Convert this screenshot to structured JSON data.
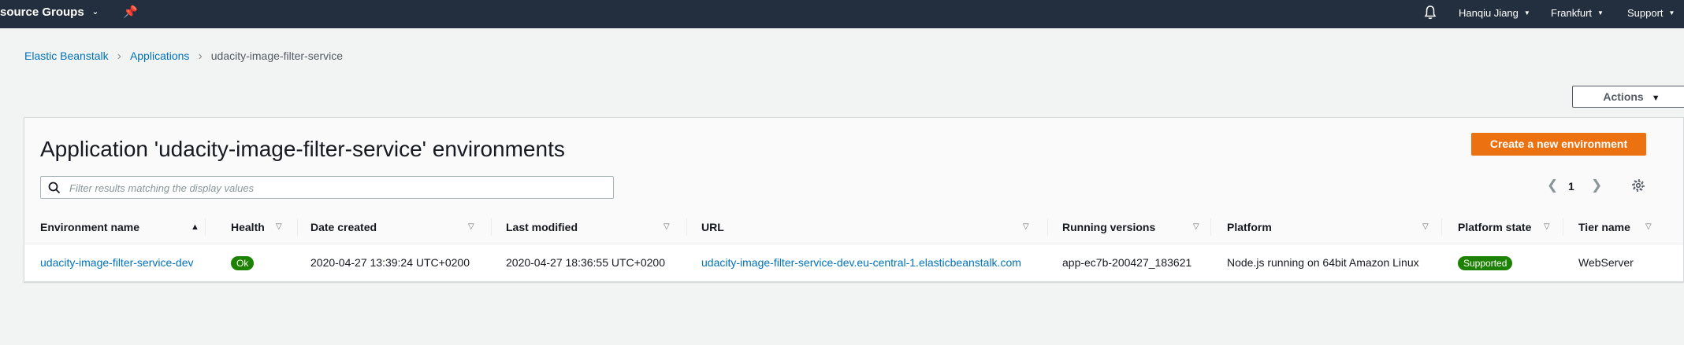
{
  "topnav": {
    "resource_groups": "source Groups",
    "user": "Hanqiu Jiang",
    "region": "Frankfurt",
    "support": "Support"
  },
  "breadcrumb": {
    "items": [
      "Elastic Beanstalk",
      "Applications"
    ],
    "current": "udacity-image-filter-service"
  },
  "actions_label": "Actions",
  "panel": {
    "title": "Application 'udacity-image-filter-service' environments",
    "create_label": "Create a new environment",
    "filter_placeholder": "Filter results matching the display values",
    "page": "1"
  },
  "table": {
    "columns": [
      "Environment name",
      "Health",
      "Date created",
      "Last modified",
      "URL",
      "Running versions",
      "Platform",
      "Platform state",
      "Tier name"
    ],
    "rows": [
      {
        "environment_name": "udacity-image-filter-service-dev",
        "health": "Ok",
        "date_created": "2020-04-27 13:39:24 UTC+0200",
        "last_modified": "2020-04-27 18:36:55 UTC+0200",
        "url": "udacity-image-filter-service-dev.eu-central-1.elasticbeanstalk.com",
        "running_versions": "app-ec7b-200427_183621",
        "platform": "Node.js running on 64bit Amazon Linux",
        "platform_state": "Supported",
        "tier_name": "WebServer"
      }
    ]
  },
  "colors": {
    "nav_bg": "#232f3e",
    "link": "#0073bb",
    "primary_button": "#ec7211",
    "status_ok": "#1d8102"
  }
}
